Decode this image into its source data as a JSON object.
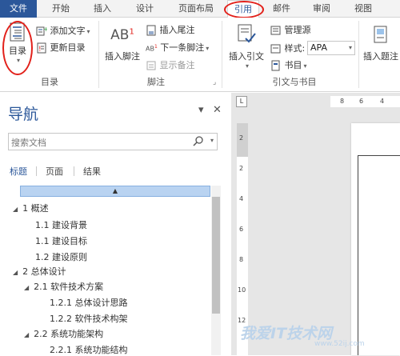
{
  "ribbon_tabs": [
    "文件",
    "开始",
    "插入",
    "设计",
    "页面布局",
    "引用",
    "邮件",
    "审阅",
    "视图"
  ],
  "active_tab": "引用",
  "groups": {
    "toc": {
      "label": "目录",
      "toc_button": "目录",
      "add_text": "添加文字",
      "update_table": "更新目录"
    },
    "footnotes": {
      "label": "脚注",
      "insert_footnote": "插入脚注",
      "insert_footnote_glyph": "AB",
      "insert_endnote": "插入尾注",
      "next_footnote": "下一条脚注",
      "show_notes": "显示备注"
    },
    "citations": {
      "label": "引文与书目",
      "insert_citation": "插入引文",
      "manage_sources": "管理源",
      "style_label": "样式:",
      "style_value": "APA",
      "bibliography": "书目"
    },
    "captions": {
      "insert_caption": "插入题注"
    }
  },
  "nav": {
    "title": "导航",
    "search_placeholder": "搜索文档",
    "tabs": [
      "标题",
      "页面",
      "结果"
    ],
    "headings": [
      {
        "text": "1 概述"
      },
      {
        "text": "1.1 建设背景"
      },
      {
        "text": "1.1 建设目标"
      },
      {
        "text": "1.2 建设原则"
      },
      {
        "text": "2 总体设计"
      },
      {
        "text": "2.1 软件技术方案"
      },
      {
        "text": "1.2.1 总体设计思路"
      },
      {
        "text": "1.2.2 软件技术构架"
      },
      {
        "text": "2.2 系统功能架构"
      },
      {
        "text": "2.2.1 系统功能结构"
      }
    ]
  },
  "ruler": {
    "h_numbers": [
      "8",
      "6",
      "4"
    ],
    "v_numbers": [
      "2",
      "2",
      "4",
      "6",
      "8",
      "10",
      "12"
    ]
  },
  "watermark": {
    "text": "我爱IT技术网",
    "url": "www.52ij.com"
  }
}
